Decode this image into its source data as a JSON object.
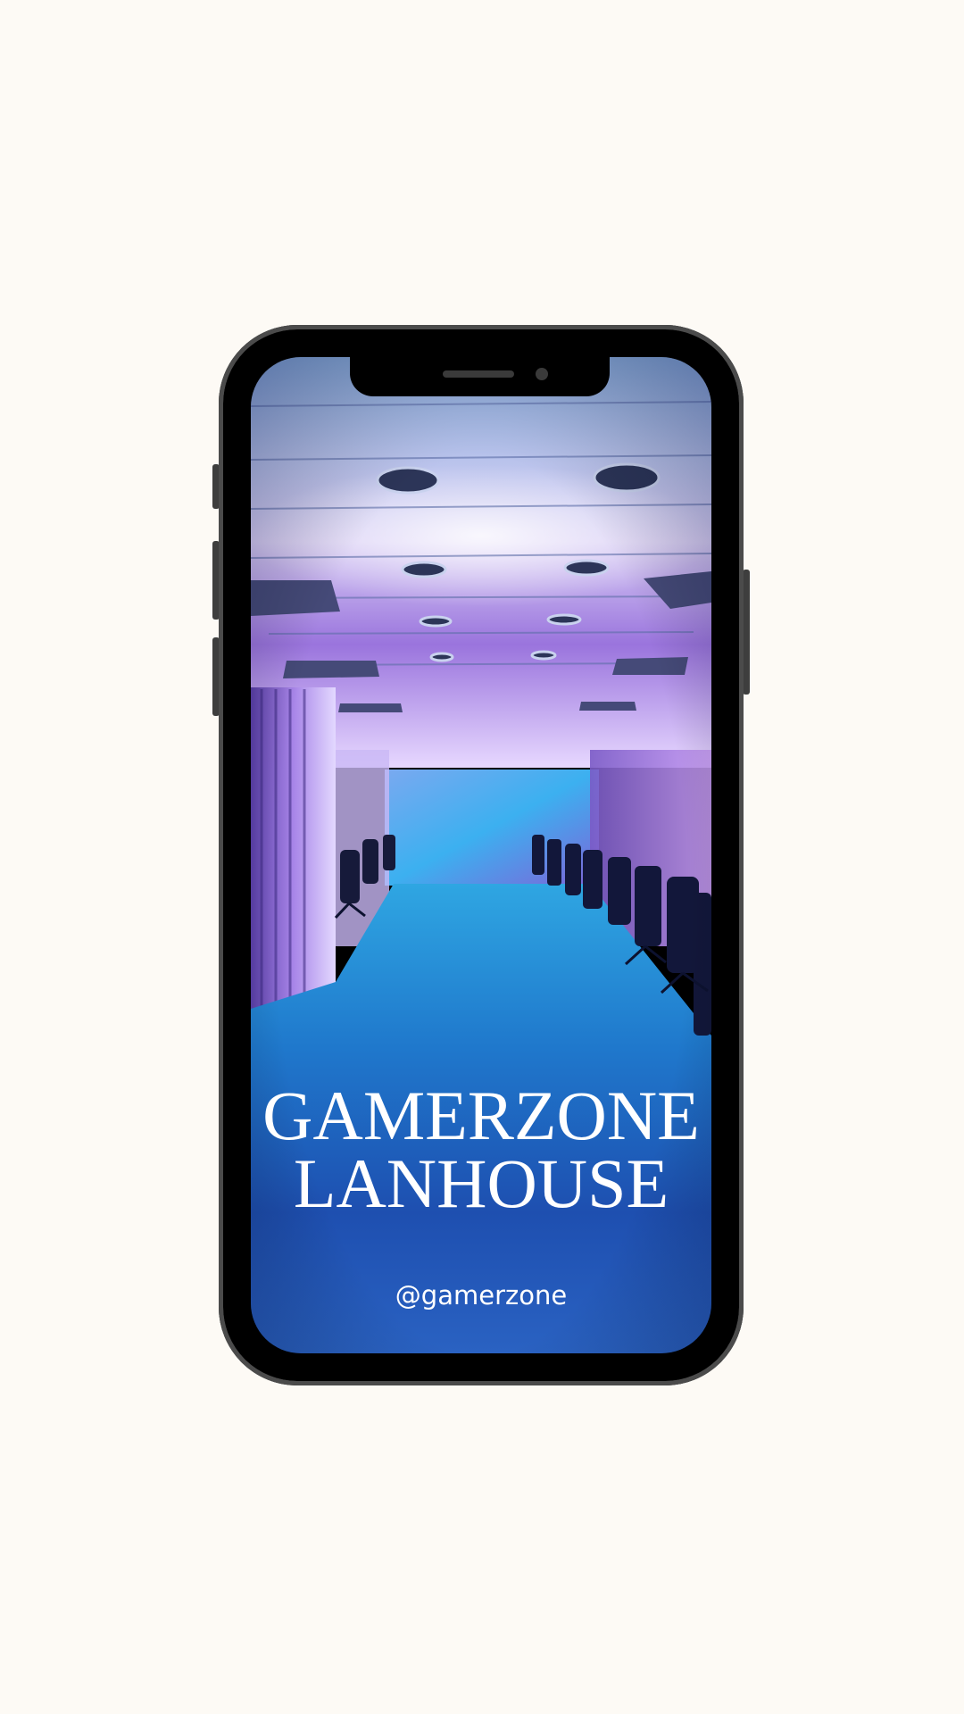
{
  "page": {
    "background_color": "#fdfaf5"
  },
  "phone": {
    "frame_color": "#000000",
    "bezel_color": "#4b4b4b"
  },
  "screen": {
    "image_description_icon": "gaming-lan-room-photo",
    "title_line1": "GAMERZONE",
    "title_line2": "LANHOUSE",
    "handle": "@gamerzone",
    "accent_colors": [
      "#6a8fd6",
      "#9b6fe0",
      "#2b8fd9",
      "#1c4fae"
    ]
  }
}
